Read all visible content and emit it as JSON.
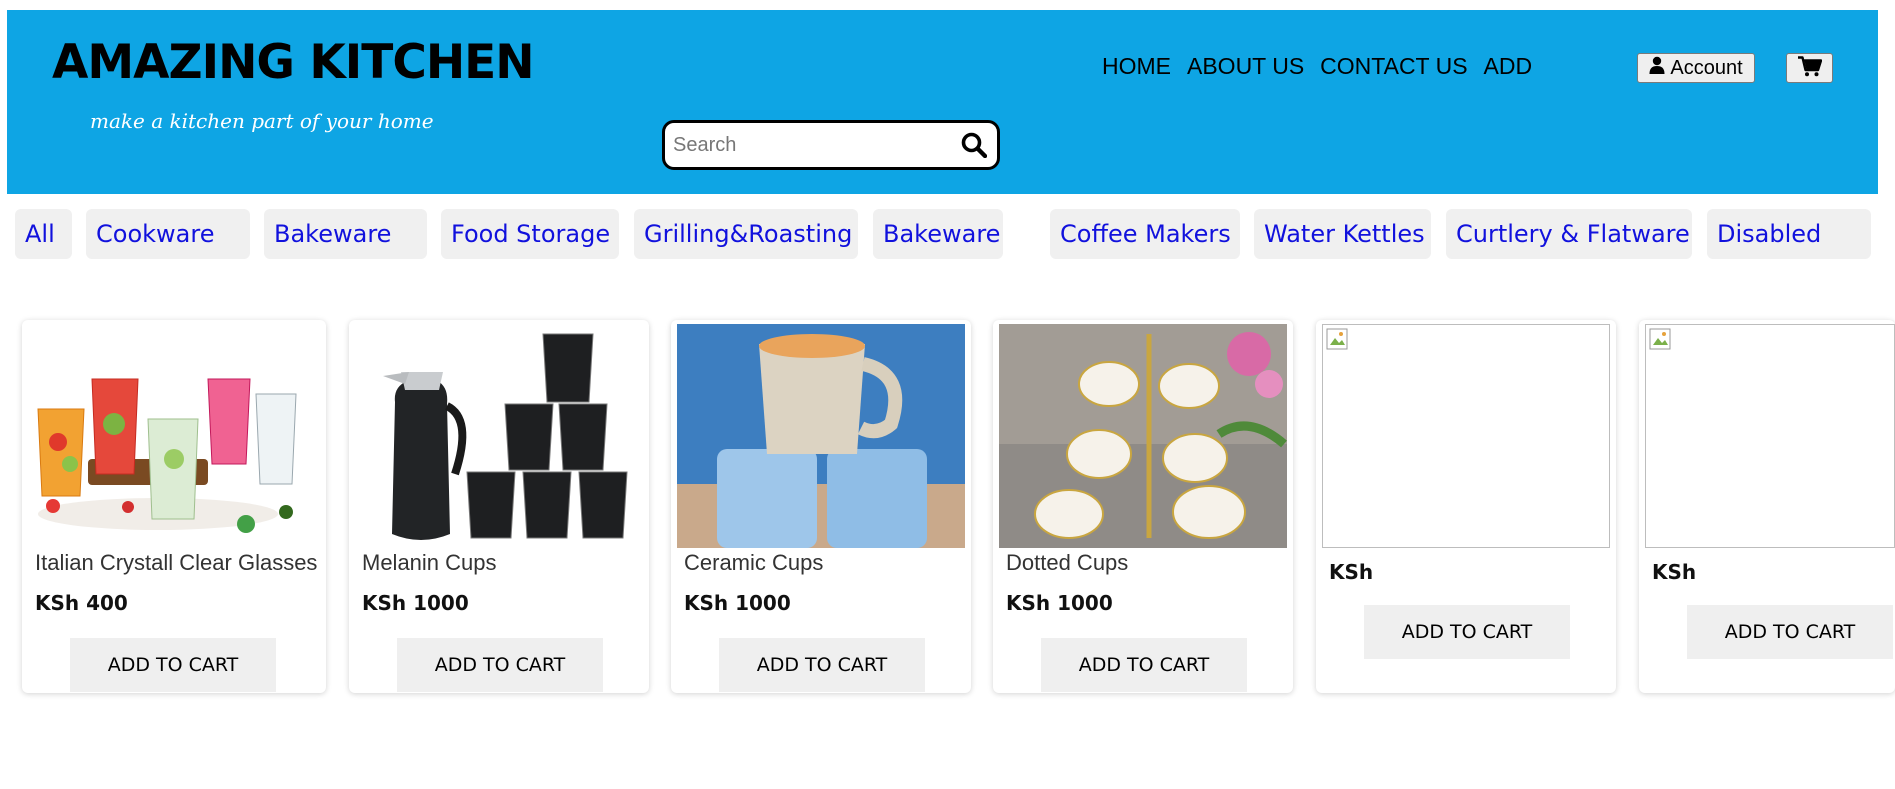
{
  "header": {
    "title": "AMAZING KITCHEN",
    "tagline": "make a kitchen part of your home",
    "nav": [
      "HOME",
      "ABOUT US",
      "CONTACT US",
      "ADD"
    ],
    "account_label": "Account",
    "search_placeholder": "Search",
    "background_color": "#0ea5e4"
  },
  "categories": [
    "All",
    "Cookware",
    "Bakeware",
    "Food Storage",
    "Grilling&Roasting",
    "Bakeware",
    "Coffee Makers",
    "Water Kettles",
    "Curtlery & Flatware",
    "Disabled"
  ],
  "products": [
    {
      "name": "Italian Crystall Clear Glasses",
      "price": "KSh 400",
      "button": "ADD TO CART",
      "image": "glasses"
    },
    {
      "name": "Melanin Cups",
      "price": "KSh 1000",
      "button": "ADD TO CART",
      "image": "melanin-cups"
    },
    {
      "name": "Ceramic Cups",
      "price": "KSh 1000",
      "button": "ADD TO CART",
      "image": "ceramic-cups"
    },
    {
      "name": "Dotted Cups",
      "price": "KSh 1000",
      "button": "ADD TO CART",
      "image": "dotted-cups"
    },
    {
      "name": "",
      "price": "KSh",
      "button": "ADD TO CART",
      "image": "broken"
    },
    {
      "name": "",
      "price": "KSh",
      "button": "ADD TO CART",
      "image": "broken"
    }
  ],
  "colors": {
    "accent": "#0ea5e4",
    "category_text": "#1111dd",
    "button_bg": "#efefef"
  }
}
